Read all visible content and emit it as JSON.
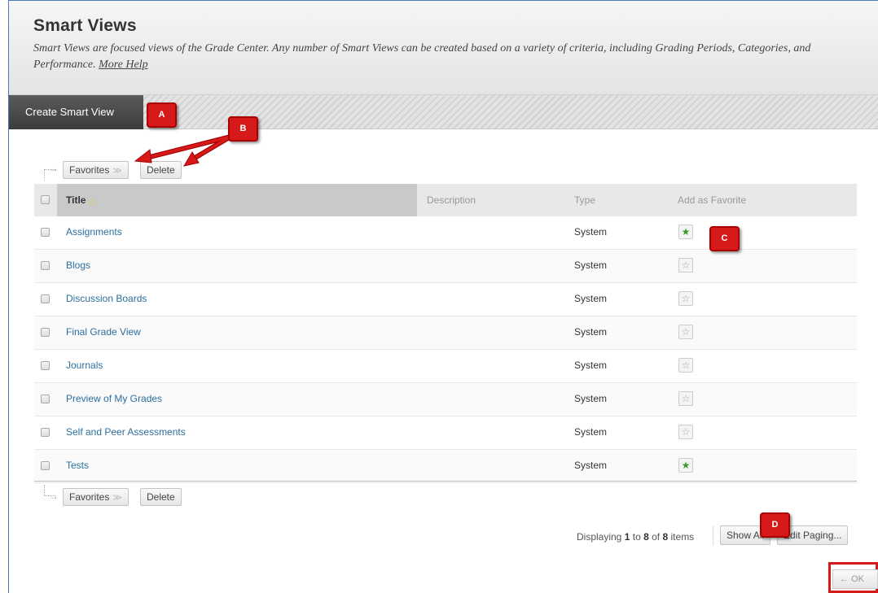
{
  "header": {
    "title": "Smart Views",
    "description": "Smart Views are focused views of the Grade Center. Any number of Smart Views can be created based on a variety of criteria, including Grading Periods, Categories, and Performance.",
    "more_help": "More Help"
  },
  "action_bar": {
    "create_label": "Create Smart View"
  },
  "callouts": {
    "a": "A",
    "b": "B",
    "c": "C",
    "d": "D"
  },
  "top_bar": {
    "favorites_label": "Favorites",
    "delete_label": "Delete"
  },
  "bottom_bar": {
    "favorites_label": "Favorites",
    "delete_label": "Delete"
  },
  "table": {
    "columns": {
      "title": "Title",
      "description": "Description",
      "type": "Type",
      "favorite": "Add as Favorite"
    },
    "rows": [
      {
        "title": "Assignments",
        "type": "System",
        "favorite": true
      },
      {
        "title": "Blogs",
        "type": "System",
        "favorite": false
      },
      {
        "title": "Discussion Boards",
        "type": "System",
        "favorite": false
      },
      {
        "title": "Final Grade View",
        "type": "System",
        "favorite": false
      },
      {
        "title": "Journals",
        "type": "System",
        "favorite": false
      },
      {
        "title": "Preview of My Grades",
        "type": "System",
        "favorite": false
      },
      {
        "title": "Self and Peer Assessments",
        "type": "System",
        "favorite": false
      },
      {
        "title": "Tests",
        "type": "System",
        "favorite": true
      }
    ]
  },
  "paging": {
    "prefix": "Displaying",
    "from": "1",
    "to_word": "to",
    "to": "8",
    "of_word": "of",
    "total": "8",
    "suffix": "items",
    "show_all": "Show All",
    "edit_paging": "Edit Paging..."
  },
  "ok_label": "← OK",
  "colors": {
    "link": "#2c6e9e",
    "callout": "#d61a1a",
    "favorite_on": "#3c9a2a"
  }
}
